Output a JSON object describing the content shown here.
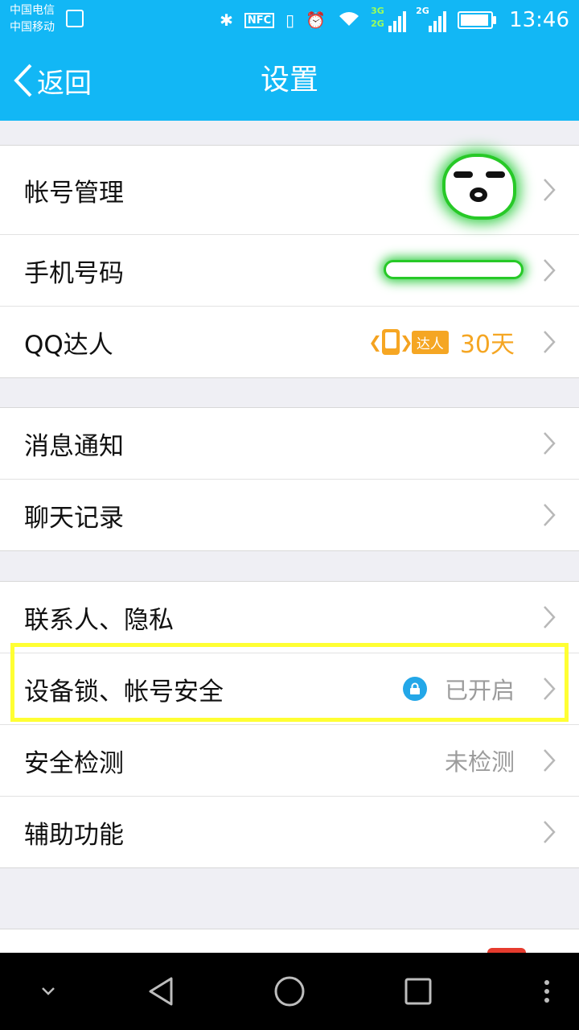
{
  "status_bar": {
    "carrier_1": "中国电信",
    "carrier_2": "中国移动",
    "network_1": "3G",
    "network_2": "2G",
    "network_3": "2G",
    "nfc": "NFC",
    "time": "13:46",
    "battery_level": 0.85
  },
  "nav": {
    "back_label": "返回",
    "title": "设置"
  },
  "groups": [
    {
      "rows": [
        {
          "label": "帐号管理"
        },
        {
          "label": "手机号码"
        },
        {
          "label": "QQ达人",
          "badge": "达人",
          "days": "30天"
        }
      ]
    },
    {
      "rows": [
        {
          "label": "消息通知"
        },
        {
          "label": "聊天记录"
        }
      ]
    },
    {
      "rows": [
        {
          "label": "联系人、隐私"
        },
        {
          "label": "设备锁、帐号安全",
          "value": "已开启"
        },
        {
          "label": "安全检测",
          "value": "未检测"
        },
        {
          "label": "辅助功能"
        }
      ]
    }
  ],
  "colors": {
    "header_blue": "#12b7f5",
    "accent_orange": "#f5a623",
    "highlight_yellow": "#ffff33",
    "lock_blue": "#23a7e8"
  }
}
